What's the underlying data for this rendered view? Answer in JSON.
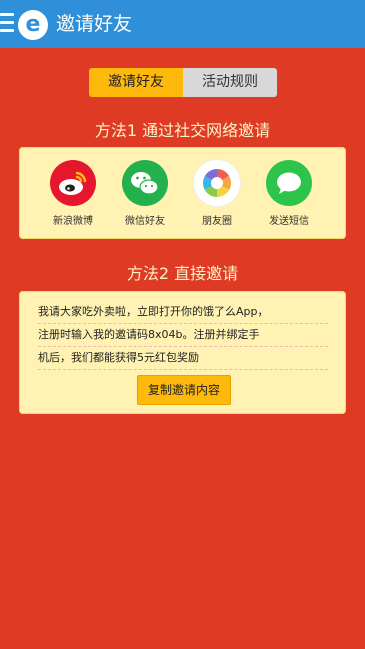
{
  "appbar": {
    "title": "邀请好友",
    "logo_letter": "e"
  },
  "tabs": [
    {
      "label": "邀请好友",
      "active": true
    },
    {
      "label": "活动规则",
      "active": false
    }
  ],
  "method1": {
    "title": "方法1  通过社交网络邀请",
    "items": [
      {
        "label": "新浪微博",
        "icon": "weibo-icon",
        "color": "#E6162D"
      },
      {
        "label": "微信好友",
        "icon": "wechat-icon",
        "color": "#22B14C"
      },
      {
        "label": "朋友圈",
        "icon": "moments-icon",
        "color": "#FFFFFF"
      },
      {
        "label": "发送短信",
        "icon": "sms-icon",
        "color": "#2DC44C"
      }
    ]
  },
  "method2": {
    "title": "方法2  直接邀请",
    "lines": [
      "我请大家吃外卖啦，立即打开你的饿了么App，",
      "注册时输入我的邀请码8x04b。注册并绑定手",
      "机后，我们都能获得5元红包奖励"
    ],
    "copy_label": "复制邀请内容"
  },
  "colors": {
    "background": "#DF3B24",
    "appbar": "#2F8FD8",
    "accent": "#FDBA0C",
    "panel": "#FFF2B3"
  }
}
